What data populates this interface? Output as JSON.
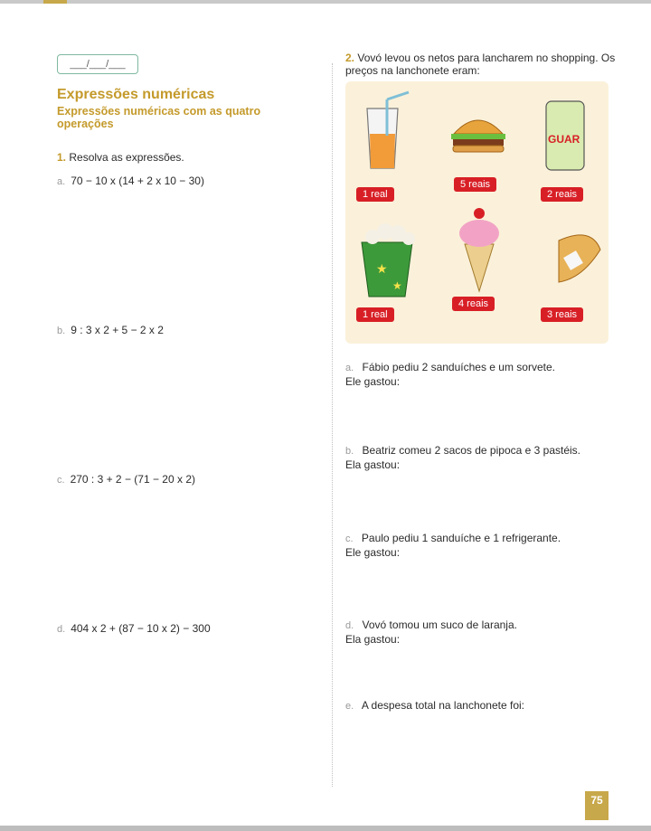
{
  "date_field": "___/___/___",
  "left": {
    "title": "Expressões numéricas",
    "subtitle": "Expressões numéricas com as quatro operações",
    "q1": {
      "num": "1.",
      "text": "Resolva as expressões."
    },
    "items": [
      {
        "label": "a.",
        "expr": "70 − 10 x (14 + 2 x 10 − 30)"
      },
      {
        "label": "b.",
        "expr": "9 : 3 x 2 + 5 − 2 x 2"
      },
      {
        "label": "c.",
        "expr": "270 : 3 + 2 − (71 − 20 x 2)"
      },
      {
        "label": "d.",
        "expr": "404 x 2 + (87 − 10 x 2) − 300"
      }
    ]
  },
  "right": {
    "q2": {
      "num": "2.",
      "text": "Vovó levou os netos para lancharem no shopping. Os preços na lanchonete eram:"
    },
    "prices": [
      "1 real",
      "5 reais",
      "2 reais",
      "1 real",
      "4 reais",
      "3 reais"
    ],
    "can_text": "GUAR",
    "subs": [
      {
        "label": "a.",
        "text": "Fábio pediu 2 sanduíches e um sorvete.",
        "spent": "Ele gastou:"
      },
      {
        "label": "b.",
        "text": "Beatriz comeu 2 sacos de pipoca e 3 pastéis.",
        "spent": "Ela gastou:"
      },
      {
        "label": "c.",
        "text": "Paulo pediu 1 sanduíche e 1 refrigerante.",
        "spent": "Ele gastou:"
      },
      {
        "label": "d.",
        "text": "Vovó tomou um suco de laranja.",
        "spent": "Ela gastou:"
      },
      {
        "label": "e.",
        "text": "A despesa total na lanchonete foi:",
        "spent": ""
      }
    ]
  },
  "page_number": "75",
  "colors": {
    "accent": "#c49a2b",
    "price_tag": "#d81f26",
    "menu_bg": "#fbf1da"
  }
}
